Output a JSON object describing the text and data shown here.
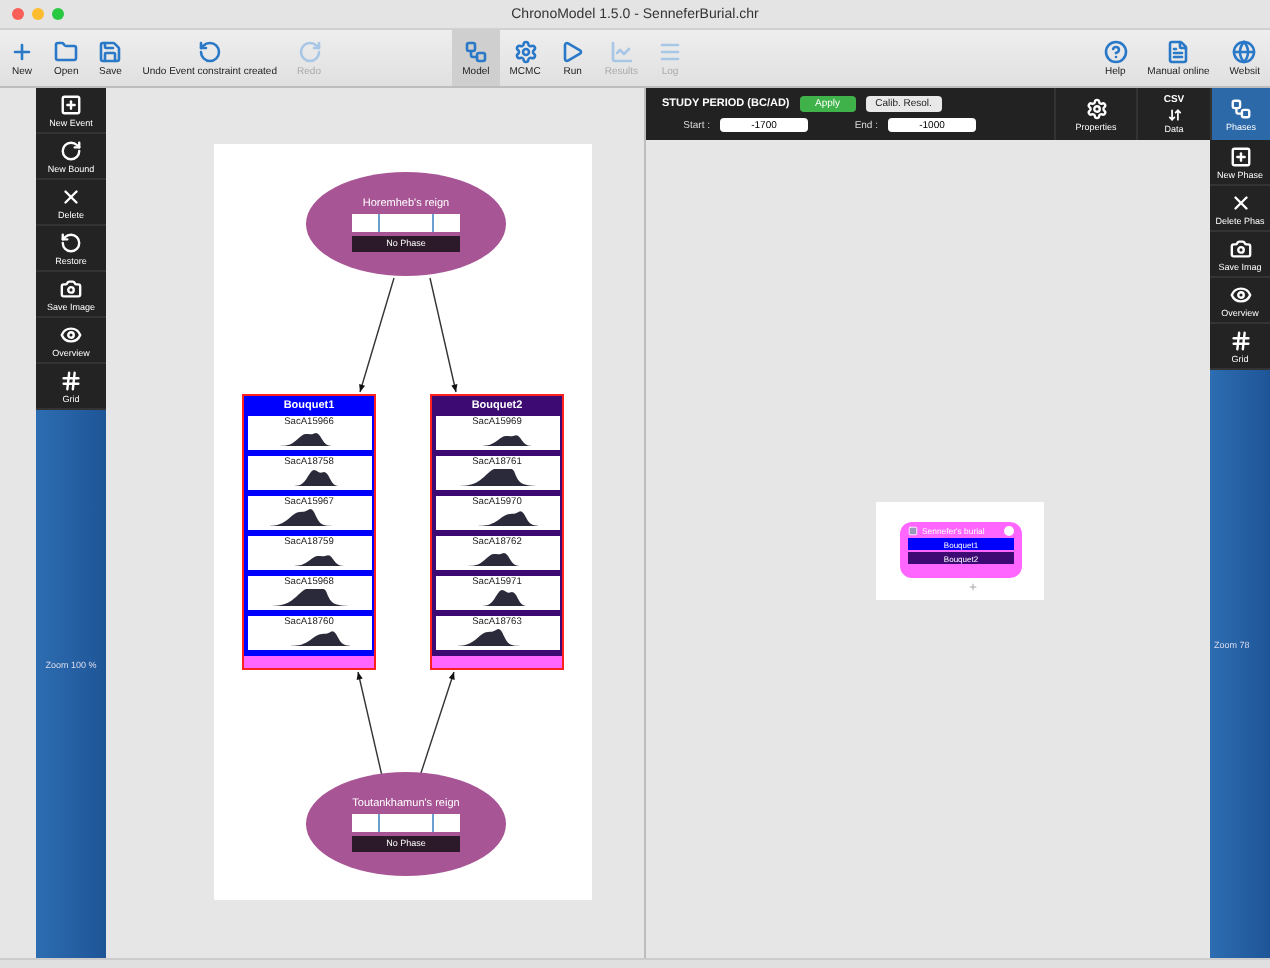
{
  "window": {
    "title": "ChronoModel 1.5.0 - SenneferBurial.chr"
  },
  "toolbar": {
    "left": [
      {
        "label": "New",
        "kind": "plus",
        "disabled": false
      },
      {
        "label": "Open",
        "kind": "folder",
        "disabled": false
      },
      {
        "label": "Save",
        "kind": "save",
        "disabled": false
      },
      {
        "label": "Undo Event constraint created",
        "kind": "undo",
        "disabled": false
      },
      {
        "label": "Redo",
        "kind": "redo",
        "disabled": true
      }
    ],
    "center": [
      {
        "label": "Model",
        "kind": "model",
        "disabled": false,
        "selected": true
      },
      {
        "label": "MCMC",
        "kind": "gear",
        "disabled": false,
        "selected": false
      },
      {
        "label": "Run",
        "kind": "play",
        "disabled": false,
        "selected": false
      },
      {
        "label": "Results",
        "kind": "chart",
        "disabled": true,
        "selected": false
      },
      {
        "label": "Log",
        "kind": "lines",
        "disabled": true,
        "selected": false
      }
    ],
    "right": [
      {
        "label": "Help",
        "kind": "help",
        "disabled": false
      },
      {
        "label": "Manual online",
        "kind": "pdf",
        "disabled": false
      },
      {
        "label": "Websit",
        "kind": "globe",
        "disabled": false
      }
    ]
  },
  "left_sidebar": {
    "tools": [
      {
        "label": "New Event",
        "kind": "new"
      },
      {
        "label": "New Bound",
        "kind": "bound"
      },
      {
        "label": "Delete",
        "kind": "delete"
      },
      {
        "label": "Restore",
        "kind": "restore"
      },
      {
        "label": "Save Image",
        "kind": "camera"
      },
      {
        "label": "Overview",
        "kind": "eye"
      },
      {
        "label": "Grid",
        "kind": "grid"
      }
    ],
    "zoom": "Zoom 100 %"
  },
  "study_period": {
    "title": "STUDY PERIOD (BC/AD)",
    "apply": "Apply",
    "calib": "Calib. Resol.",
    "start_label": "Start :",
    "start": "-1700",
    "end_label": "End :",
    "end": "-1000"
  },
  "right_tabs": [
    {
      "label": "Properties",
      "kind": "gear",
      "selected": false
    },
    {
      "label": "Data",
      "kind": "csv",
      "badge": "CSV",
      "selected": false
    },
    {
      "label": "Phases",
      "kind": "model",
      "selected": true
    }
  ],
  "right_sidebar": {
    "tools": [
      {
        "label": "New Phase",
        "kind": "new"
      },
      {
        "label": "Delete Phas",
        "kind": "delete"
      },
      {
        "label": "Save Imag",
        "kind": "camera"
      },
      {
        "label": "Overview",
        "kind": "eye"
      },
      {
        "label": "Grid",
        "kind": "grid"
      }
    ],
    "zoom": "Zoom 78"
  },
  "events_scene": {
    "bounds": [
      {
        "name": "Horemheb's reign",
        "phase": "No Phase"
      },
      {
        "name": "Toutankhamun's reign",
        "phase": "No Phase"
      }
    ],
    "events": [
      {
        "name": "Bouquet1",
        "color": "#0000ff",
        "dates": [
          "SacA15966",
          "SacA18758",
          "SacA15967",
          "SacA18759",
          "SacA15968",
          "SacA18760"
        ]
      },
      {
        "name": "Bouquet2",
        "color": "#3c0a72",
        "dates": [
          "SacA15969",
          "SacA18761",
          "SacA15970",
          "SacA18762",
          "SacA15971",
          "SacA18763"
        ]
      }
    ]
  },
  "phases_scene": {
    "phases": [
      {
        "name": "Sennefer's burial",
        "events": [
          {
            "name": "Bouquet1",
            "color": "#0000ff"
          },
          {
            "name": "Bouquet2",
            "color": "#3c0a72"
          }
        ]
      }
    ]
  }
}
